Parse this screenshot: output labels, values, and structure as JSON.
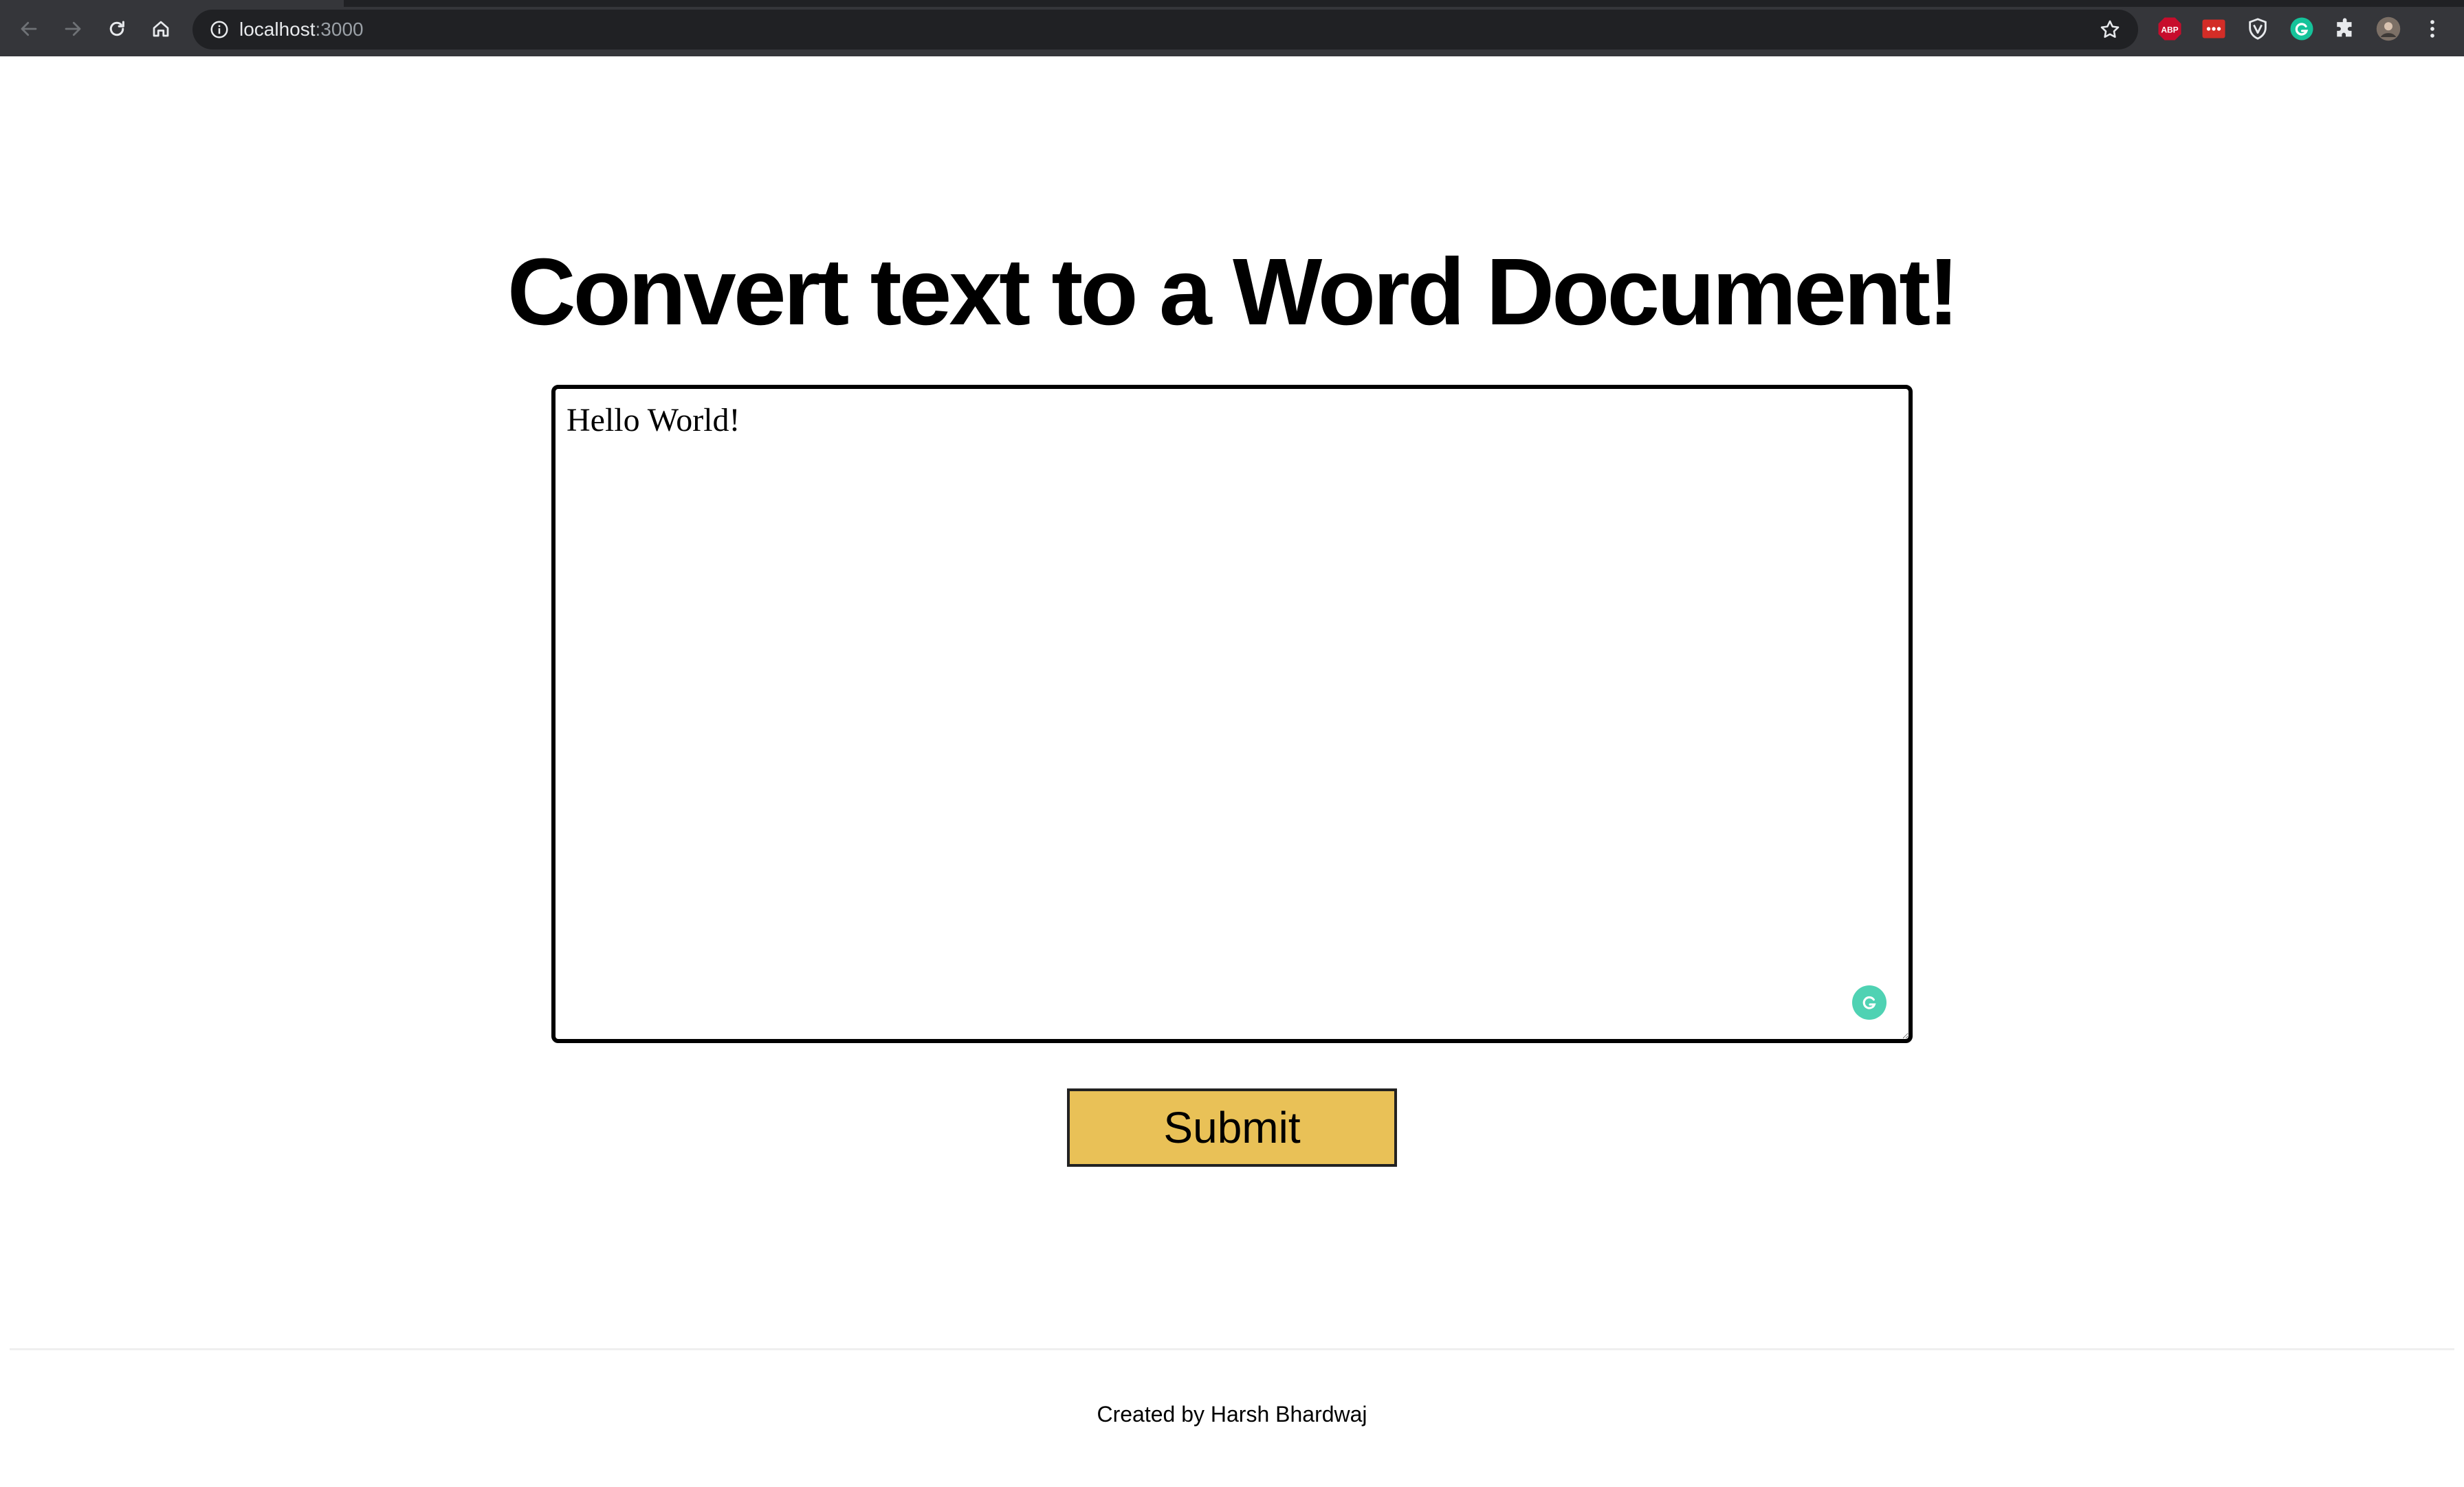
{
  "browser": {
    "url_host": "localhost",
    "url_port": ":3000",
    "extensions": [
      {
        "name": "adblock-plus-icon",
        "label": "ABP",
        "color": "#c70d2c"
      },
      {
        "name": "lastpass-icon",
        "label": "•••",
        "color": "#d32d27"
      },
      {
        "name": "shield-extension-icon",
        "label": "",
        "color": "#e8eaed"
      },
      {
        "name": "grammarly-extension-icon",
        "label": "G",
        "color": "#15c39a"
      },
      {
        "name": "puzzle-icon",
        "label": "",
        "color": "#e8eaed"
      },
      {
        "name": "profile-avatar",
        "label": "",
        "color": "#8a7a6a"
      }
    ]
  },
  "main": {
    "title": "Convert text to a Word Document!",
    "textarea_value": "Hello World!",
    "submit_label": "Submit",
    "submit_color": "#e9c157"
  },
  "footer": {
    "credit": "Created by Harsh Bhardwaj"
  }
}
